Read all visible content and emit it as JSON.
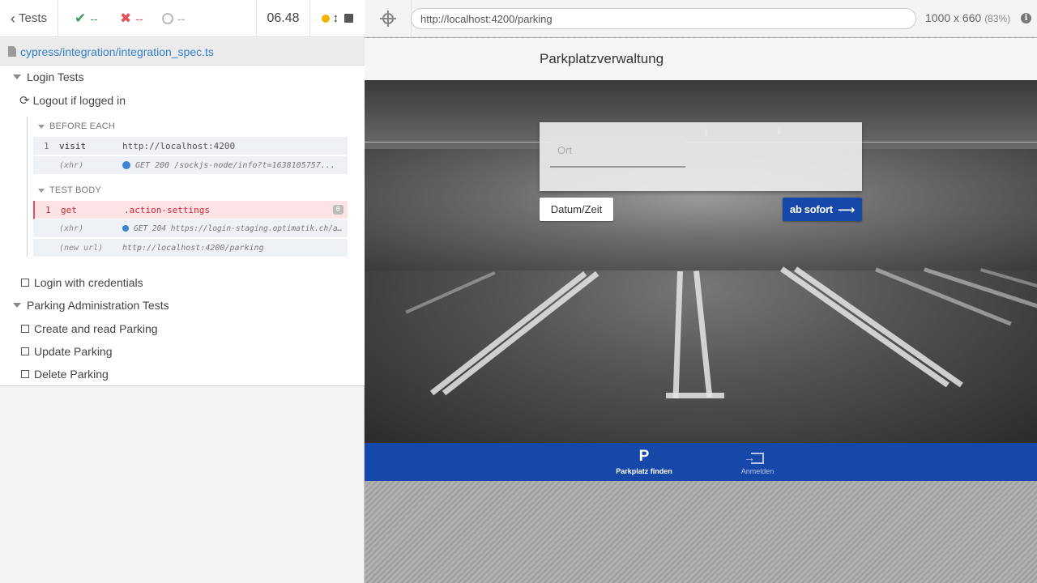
{
  "reporter": {
    "back_label": "Tests",
    "passed": "--",
    "failed": "--",
    "pending": "--",
    "duration": "06.48",
    "spec_path": "cypress/integration/integration_spec.ts"
  },
  "tree": {
    "suite1": "Login Tests",
    "test_running": "Logout if logged in",
    "before_each": "BEFORE EACH",
    "test_body": "TEST BODY",
    "commands_before": [
      {
        "n": "1",
        "name": "visit",
        "msg": "http://localhost:4200"
      },
      {
        "n": "",
        "name": "(xhr)",
        "msg": "GET 200 /sockjs-node/info?t=1638105757..."
      }
    ],
    "commands_body": [
      {
        "n": "1",
        "name": "get",
        "msg": ".action-settings",
        "count": "0"
      },
      {
        "n": "",
        "name": "(xhr)",
        "msg": "GET 204 https://login-staging.optimatik.ch/a..."
      },
      {
        "n": "",
        "name": "(new url)",
        "msg": "http://localhost:4200/parking"
      }
    ],
    "test_login_credentials": "Login with credentials",
    "suite2": "Parking Administration Tests",
    "suite2_tests": [
      "Create and read Parking",
      "Update Parking",
      "Delete Parking"
    ]
  },
  "aut_header": {
    "url": "http://localhost:4200/parking",
    "viewport": "1000 x 660",
    "scale": "(83%)"
  },
  "app": {
    "title": "Parkplatzverwaltung",
    "ort_placeholder": "Ort",
    "datum_button": "Datum/Zeit",
    "sofort_button": "ab sofort",
    "nav": [
      {
        "icon": "P",
        "label": "Parkplatz finden"
      },
      {
        "icon": "login",
        "label": "Anmelden"
      }
    ]
  },
  "colors": {
    "brand_blue": "#1548a8",
    "pass_green": "#3a9c55",
    "fail_red": "#e94f5b"
  }
}
